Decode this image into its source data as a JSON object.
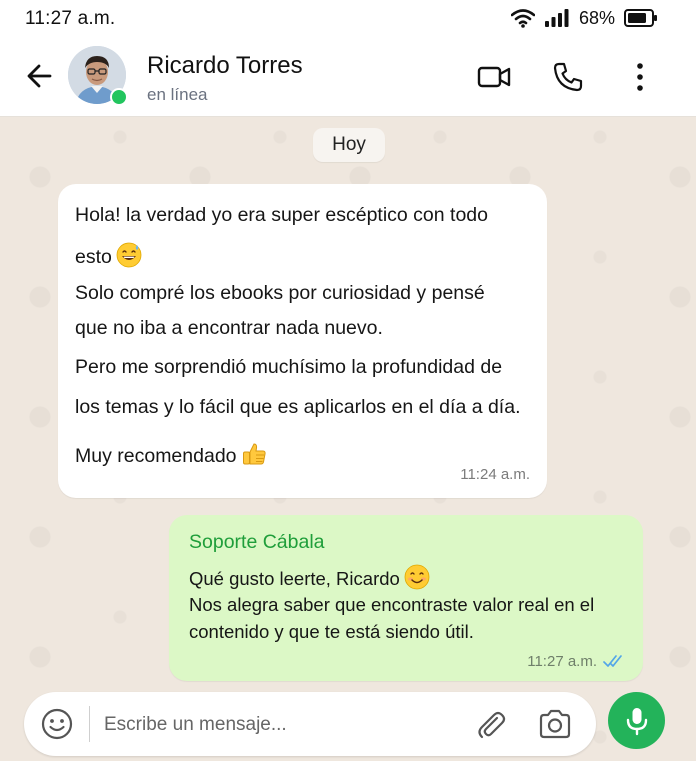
{
  "status_bar": {
    "time": "11:27 a.m.",
    "battery": "68%"
  },
  "header": {
    "contact_name": "Ricardo Torres",
    "contact_status": "en línea",
    "icons": [
      "back-arrow-icon",
      "video-call-icon",
      "phone-icon",
      "more-vertical-icon"
    ]
  },
  "chat": {
    "day_label": "Hoy",
    "incoming": {
      "lines": [
        "Hola! la verdad yo era super escéptico con todo",
        "esto",
        "Solo compré los ebooks por curiosidad y pensé",
        "que no iba a encontrar nada nuevo.",
        "Pero me sorprendió muchísimo la profundidad de",
        "los temas y lo fácil que es aplicarlos en el día a día.",
        "Muy recomendado"
      ],
      "emojis": [
        "grinning-sweat-emoji",
        "thumbs-up-emoji"
      ],
      "time": "11:24 a.m."
    },
    "outgoing": {
      "sender": "Soporte Cábala",
      "lines": [
        "Qué gusto leerte, Ricardo",
        "Nos alegra saber que encontraste valor real en el",
        "contenido y que te está siendo útil."
      ],
      "emoji": "smiling-emoji",
      "time": "11:27 a.m.",
      "read_receipt": "double-check-icon"
    }
  },
  "composer": {
    "placeholder": "Escribe un mensaje...",
    "icons": [
      "emoji-icon",
      "attach-icon",
      "camera-icon",
      "mic-icon"
    ]
  },
  "colors": {
    "accent_green": "#23b35a",
    "sender_green": "#1f9e3a",
    "outgoing_bubble": "#dcf8c6",
    "chat_background": "#efe7de",
    "read_tick_blue": "#53a6e8"
  }
}
